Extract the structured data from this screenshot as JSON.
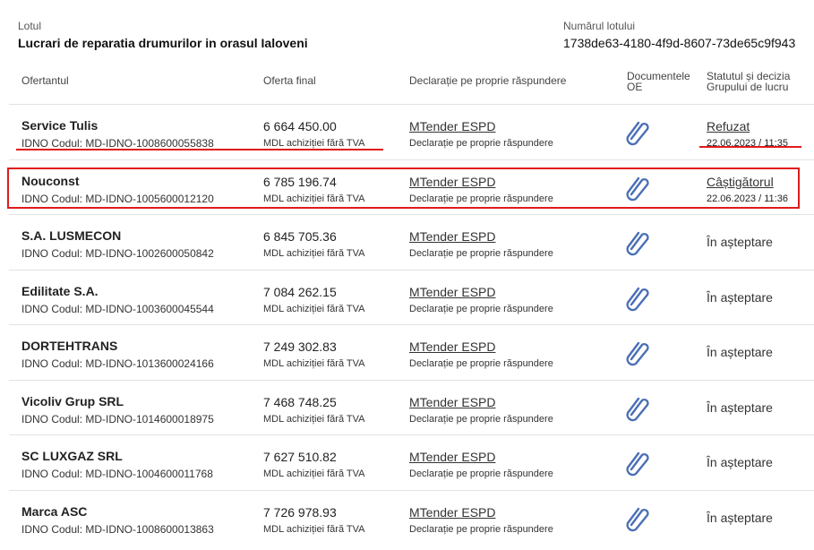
{
  "lot": {
    "label": "Lotul",
    "title": "Lucrari de reparatia drumurilor in orasul Ialoveni",
    "number_label": "Numărul lotului",
    "number_value": "1738de63-4180-4f9d-8607-73de65c9f943"
  },
  "columns": {
    "bidder": "Ofertantul",
    "final_offer": "Oferta final",
    "declaration": "Declarație pe proprie răspundere",
    "documents": "Documentele OE",
    "status": "Statutul și decizia Grupului de lucru"
  },
  "highlight_color": "#e01b1b",
  "rows": [
    {
      "name": "Service Tulis",
      "idno": "IDNO Codul: MD-IDNO-1008600055838",
      "price": "6 664 450.00",
      "price_note": "MDL achiziției fără TVA",
      "decl_link": "MTender ESPD",
      "decl_note": "Declarație pe proprie răspundere",
      "doc_icon": "paperclip-icon",
      "status": "Refuzat",
      "status_date": "22.06.2023 / 11:35"
    },
    {
      "name": "Nouconst",
      "idno": "IDNO Codul: MD-IDNO-1005600012120",
      "price": "6 785 196.74",
      "price_note": "MDL achiziției fără TVA",
      "decl_link": "MTender ESPD",
      "decl_note": "Declarație pe proprie răspundere",
      "doc_icon": "paperclip-icon",
      "status": "Câștigătorul",
      "status_date": "22.06.2023 / 11:36"
    },
    {
      "name": "S.A. LUSMECON",
      "idno": "IDNO Codul: MD-IDNO-1002600050842",
      "price": "6 845 705.36",
      "price_note": "MDL achiziției fără TVA",
      "decl_link": "MTender ESPD",
      "decl_note": "Declarație pe proprie răspundere",
      "doc_icon": "paperclip-icon",
      "status": "În așteptare"
    },
    {
      "name": "Edilitate S.A.",
      "idno": "IDNO Codul: MD-IDNO-1003600045544",
      "price": "7 084 262.15",
      "price_note": "MDL achiziției fără TVA",
      "decl_link": "MTender ESPD",
      "decl_note": "Declarație pe proprie răspundere",
      "doc_icon": "paperclip-icon",
      "status": "În așteptare"
    },
    {
      "name": "DORTEHTRANS",
      "idno": "IDNO Codul: MD-IDNO-1013600024166",
      "price": "7 249 302.83",
      "price_note": "MDL achiziției fără TVA",
      "decl_link": "MTender ESPD",
      "decl_note": "Declarație pe proprie răspundere",
      "doc_icon": "paperclip-icon",
      "status": "În așteptare"
    },
    {
      "name": "Vicoliv Grup SRL",
      "idno": "IDNO Codul: MD-IDNO-1014600018975",
      "price": "7 468 748.25",
      "price_note": "MDL achiziției fără TVA",
      "decl_link": "MTender ESPD",
      "decl_note": "Declarație pe proprie răspundere",
      "doc_icon": "paperclip-icon",
      "status": "În așteptare"
    },
    {
      "name": "SC LUXGAZ SRL",
      "idno": "IDNO Codul: MD-IDNO-1004600011768",
      "price": "7 627 510.82",
      "price_note": "MDL achiziției fără TVA",
      "decl_link": "MTender ESPD",
      "decl_note": "Declarație pe proprie răspundere",
      "doc_icon": "paperclip-icon",
      "status": "În așteptare"
    },
    {
      "name": "Marca ASC",
      "idno": "IDNO Codul: MD-IDNO-1008600013863",
      "price": "7 726 978.93",
      "price_note": "MDL achiziției fără TVA",
      "decl_link": "MTender ESPD",
      "decl_note": "Declarație pe proprie răspundere",
      "doc_icon": "paperclip-icon",
      "status": "În așteptare"
    }
  ]
}
